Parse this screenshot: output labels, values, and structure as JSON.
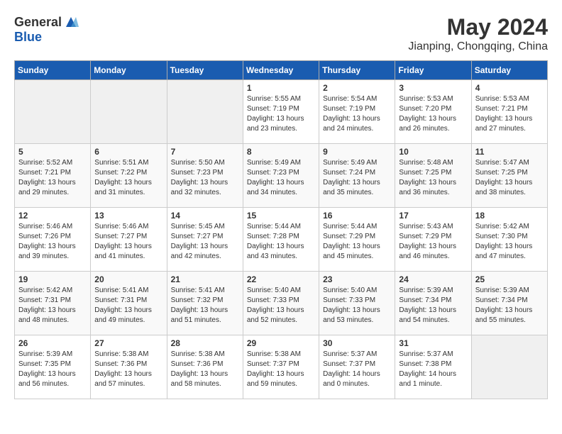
{
  "header": {
    "logo_general": "General",
    "logo_blue": "Blue",
    "month_year": "May 2024",
    "location": "Jianping, Chongqing, China"
  },
  "days_of_week": [
    "Sunday",
    "Monday",
    "Tuesday",
    "Wednesday",
    "Thursday",
    "Friday",
    "Saturday"
  ],
  "weeks": [
    [
      {
        "day": "",
        "info": ""
      },
      {
        "day": "",
        "info": ""
      },
      {
        "day": "",
        "info": ""
      },
      {
        "day": "1",
        "info": "Sunrise: 5:55 AM\nSunset: 7:19 PM\nDaylight: 13 hours\nand 23 minutes."
      },
      {
        "day": "2",
        "info": "Sunrise: 5:54 AM\nSunset: 7:19 PM\nDaylight: 13 hours\nand 24 minutes."
      },
      {
        "day": "3",
        "info": "Sunrise: 5:53 AM\nSunset: 7:20 PM\nDaylight: 13 hours\nand 26 minutes."
      },
      {
        "day": "4",
        "info": "Sunrise: 5:53 AM\nSunset: 7:21 PM\nDaylight: 13 hours\nand 27 minutes."
      }
    ],
    [
      {
        "day": "5",
        "info": "Sunrise: 5:52 AM\nSunset: 7:21 PM\nDaylight: 13 hours\nand 29 minutes."
      },
      {
        "day": "6",
        "info": "Sunrise: 5:51 AM\nSunset: 7:22 PM\nDaylight: 13 hours\nand 31 minutes."
      },
      {
        "day": "7",
        "info": "Sunrise: 5:50 AM\nSunset: 7:23 PM\nDaylight: 13 hours\nand 32 minutes."
      },
      {
        "day": "8",
        "info": "Sunrise: 5:49 AM\nSunset: 7:23 PM\nDaylight: 13 hours\nand 34 minutes."
      },
      {
        "day": "9",
        "info": "Sunrise: 5:49 AM\nSunset: 7:24 PM\nDaylight: 13 hours\nand 35 minutes."
      },
      {
        "day": "10",
        "info": "Sunrise: 5:48 AM\nSunset: 7:25 PM\nDaylight: 13 hours\nand 36 minutes."
      },
      {
        "day": "11",
        "info": "Sunrise: 5:47 AM\nSunset: 7:25 PM\nDaylight: 13 hours\nand 38 minutes."
      }
    ],
    [
      {
        "day": "12",
        "info": "Sunrise: 5:46 AM\nSunset: 7:26 PM\nDaylight: 13 hours\nand 39 minutes."
      },
      {
        "day": "13",
        "info": "Sunrise: 5:46 AM\nSunset: 7:27 PM\nDaylight: 13 hours\nand 41 minutes."
      },
      {
        "day": "14",
        "info": "Sunrise: 5:45 AM\nSunset: 7:27 PM\nDaylight: 13 hours\nand 42 minutes."
      },
      {
        "day": "15",
        "info": "Sunrise: 5:44 AM\nSunset: 7:28 PM\nDaylight: 13 hours\nand 43 minutes."
      },
      {
        "day": "16",
        "info": "Sunrise: 5:44 AM\nSunset: 7:29 PM\nDaylight: 13 hours\nand 45 minutes."
      },
      {
        "day": "17",
        "info": "Sunrise: 5:43 AM\nSunset: 7:29 PM\nDaylight: 13 hours\nand 46 minutes."
      },
      {
        "day": "18",
        "info": "Sunrise: 5:42 AM\nSunset: 7:30 PM\nDaylight: 13 hours\nand 47 minutes."
      }
    ],
    [
      {
        "day": "19",
        "info": "Sunrise: 5:42 AM\nSunset: 7:31 PM\nDaylight: 13 hours\nand 48 minutes."
      },
      {
        "day": "20",
        "info": "Sunrise: 5:41 AM\nSunset: 7:31 PM\nDaylight: 13 hours\nand 49 minutes."
      },
      {
        "day": "21",
        "info": "Sunrise: 5:41 AM\nSunset: 7:32 PM\nDaylight: 13 hours\nand 51 minutes."
      },
      {
        "day": "22",
        "info": "Sunrise: 5:40 AM\nSunset: 7:33 PM\nDaylight: 13 hours\nand 52 minutes."
      },
      {
        "day": "23",
        "info": "Sunrise: 5:40 AM\nSunset: 7:33 PM\nDaylight: 13 hours\nand 53 minutes."
      },
      {
        "day": "24",
        "info": "Sunrise: 5:39 AM\nSunset: 7:34 PM\nDaylight: 13 hours\nand 54 minutes."
      },
      {
        "day": "25",
        "info": "Sunrise: 5:39 AM\nSunset: 7:34 PM\nDaylight: 13 hours\nand 55 minutes."
      }
    ],
    [
      {
        "day": "26",
        "info": "Sunrise: 5:39 AM\nSunset: 7:35 PM\nDaylight: 13 hours\nand 56 minutes."
      },
      {
        "day": "27",
        "info": "Sunrise: 5:38 AM\nSunset: 7:36 PM\nDaylight: 13 hours\nand 57 minutes."
      },
      {
        "day": "28",
        "info": "Sunrise: 5:38 AM\nSunset: 7:36 PM\nDaylight: 13 hours\nand 58 minutes."
      },
      {
        "day": "29",
        "info": "Sunrise: 5:38 AM\nSunset: 7:37 PM\nDaylight: 13 hours\nand 59 minutes."
      },
      {
        "day": "30",
        "info": "Sunrise: 5:37 AM\nSunset: 7:37 PM\nDaylight: 14 hours\nand 0 minutes."
      },
      {
        "day": "31",
        "info": "Sunrise: 5:37 AM\nSunset: 7:38 PM\nDaylight: 14 hours\nand 1 minute."
      },
      {
        "day": "",
        "info": ""
      }
    ]
  ]
}
